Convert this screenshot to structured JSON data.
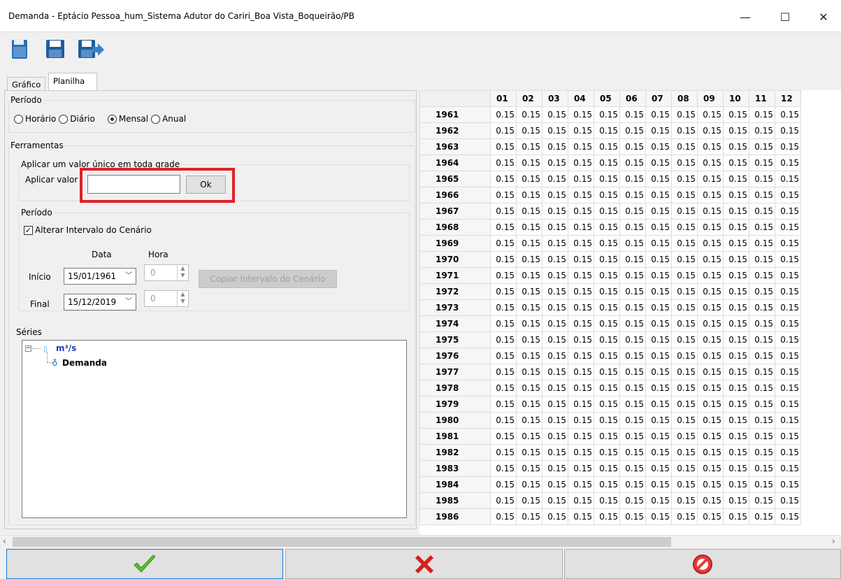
{
  "window": {
    "title": "Demanda - Eptácio Pessoa_hum_Sistema Adutor do Cariri_Boa Vista_Boqueirão/PB",
    "minimize": "—",
    "maximize": "☐",
    "close": "✕"
  },
  "tabs": [
    {
      "label": "Gráfico"
    },
    {
      "label": "Planilha"
    }
  ],
  "periodo": {
    "legend": "Período",
    "options": [
      "Horário",
      "Diário",
      "Mensal",
      "Anual"
    ],
    "selected": "Mensal"
  },
  "ferramentas": {
    "legend": "Ferramentas",
    "sub_legend": "Aplicar um valor único em toda grade",
    "apply_label": "Aplicar valor",
    "apply_value": "",
    "ok_label": "Ok"
  },
  "periodo2": {
    "legend": "Período",
    "checkbox_label": "Alterar Intervalo do Cenário",
    "checked": true,
    "col_data": "Data",
    "col_hora": "Hora",
    "inicio_label": "Início",
    "inicio_date": "15/01/1961",
    "inicio_hour": "0",
    "final_label": "Final",
    "final_date": "15/12/2019",
    "final_hour": "0",
    "copy_button": "Copiar Intervalo do Cenário"
  },
  "series": {
    "legend": "Séries",
    "root_label": "m³/s",
    "child_label": "Demanda"
  },
  "grid": {
    "months": [
      "01",
      "02",
      "03",
      "04",
      "05",
      "06",
      "07",
      "08",
      "09",
      "10",
      "11",
      "12"
    ],
    "years": [
      "1961",
      "1962",
      "1963",
      "1964",
      "1965",
      "1966",
      "1967",
      "1968",
      "1969",
      "1970",
      "1971",
      "1972",
      "1973",
      "1974",
      "1975",
      "1976",
      "1977",
      "1978",
      "1979",
      "1980",
      "1981",
      "1982",
      "1983",
      "1984",
      "1985",
      "1986"
    ],
    "value": "0.15"
  },
  "colors": {
    "highlight": "#e0202a",
    "confirm": "#5cbf2a",
    "cancel": "#d62020"
  },
  "bottom_buttons": [
    "confirm-icon",
    "cancel-icon",
    "forbidden-icon"
  ]
}
